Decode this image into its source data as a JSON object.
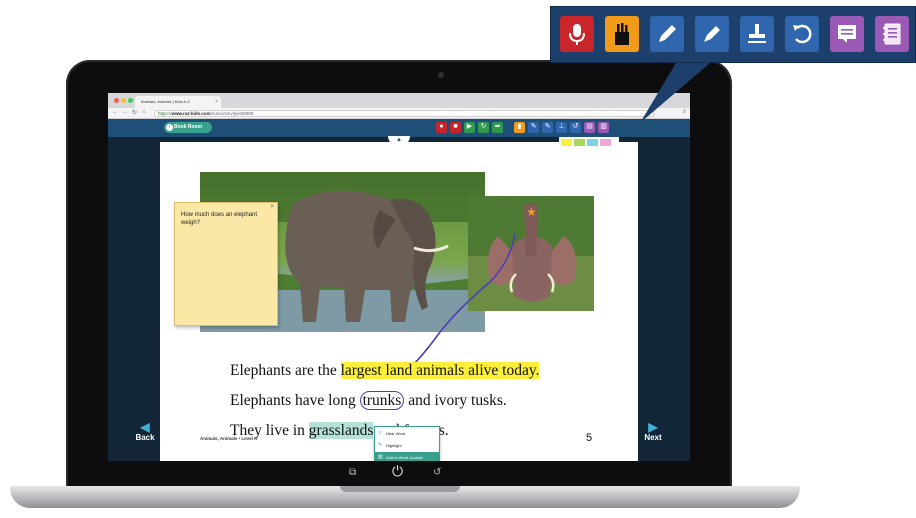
{
  "browser": {
    "tab_title": "Animals, Animals | Kids A-Z",
    "tab_close": "×",
    "url_prefix": "https://",
    "url_domain": "www.raz-kids.com",
    "url_path": "/main/Activity/id/8808"
  },
  "app": {
    "book_room_label": "Book Room",
    "collapse_glyph": "▲",
    "toolbar_tools": [
      "Record",
      "Stop",
      "Play",
      "Retry",
      "Send",
      "Highlighter",
      "Pencil",
      "Pen",
      "Stamp",
      "Undo",
      "Note",
      "Journal"
    ],
    "highlight_colors": [
      "#fbef3a",
      "#a6d75b",
      "#7fd3e6",
      "#f0a8d8"
    ],
    "back_label": "Back",
    "next_label": "Next"
  },
  "page": {
    "sticky_note": "How much does an elephant weigh?",
    "sticky_close": "×",
    "lines": [
      {
        "before": "Elephants are the ",
        "highlighted": "largest land animals alive today.",
        "after": ""
      },
      {
        "before": "Elephants have long ",
        "circled": "trunks",
        "after": " and ivory tusks."
      },
      {
        "before": "They live in ",
        "highlighted": "grasslands",
        "after": " and forests."
      }
    ],
    "footer": "Animals, Animals • Level K",
    "page_number": "5"
  },
  "word_popup": {
    "items": [
      "Hear Word",
      "Highlight",
      "Add to Word Journal"
    ]
  },
  "zoomed_toolbar": {
    "tools": [
      {
        "name": "microphone",
        "color": "#c8262b"
      },
      {
        "name": "highlighter-cup",
        "color": "#f29a1a"
      },
      {
        "name": "pencil",
        "color": "#2f66ad"
      },
      {
        "name": "pen",
        "color": "#2f66ad"
      },
      {
        "name": "stamp",
        "color": "#2f66ad"
      },
      {
        "name": "undo",
        "color": "#2f66ad"
      },
      {
        "name": "note",
        "color": "#9a59b5"
      },
      {
        "name": "journal",
        "color": "#9a59b5"
      }
    ]
  },
  "laptop": {
    "buttons": [
      "⧉",
      "⏻",
      "↺"
    ]
  }
}
